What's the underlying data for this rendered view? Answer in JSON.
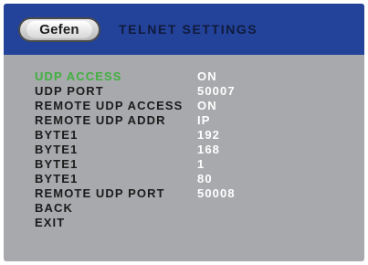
{
  "header": {
    "logo_text": "Gefen",
    "title": "TELNET SETTINGS"
  },
  "colors": {
    "header_bg": "#23439a",
    "screen_bg": "#a7a9ac",
    "selected_label": "#41b040",
    "value_text": "#ffffff"
  },
  "menu": {
    "items": [
      {
        "label": "UDP ACCESS",
        "value": "ON",
        "selected": true
      },
      {
        "label": "UDP PORT",
        "value": "50007"
      },
      {
        "label": "REMOTE UDP ACCESS",
        "value": "ON"
      },
      {
        "label": "REMOTE UDP ADDR",
        "value": "IP"
      },
      {
        "label": "BYTE1",
        "value": "192"
      },
      {
        "label": "BYTE1",
        "value": "168"
      },
      {
        "label": "BYTE1",
        "value": "1"
      },
      {
        "label": "BYTE1",
        "value": "80"
      },
      {
        "label": "REMOTE UDP PORT",
        "value": "50008"
      },
      {
        "label": "BACK",
        "value": ""
      },
      {
        "label": "EXIT",
        "value": ""
      }
    ]
  }
}
